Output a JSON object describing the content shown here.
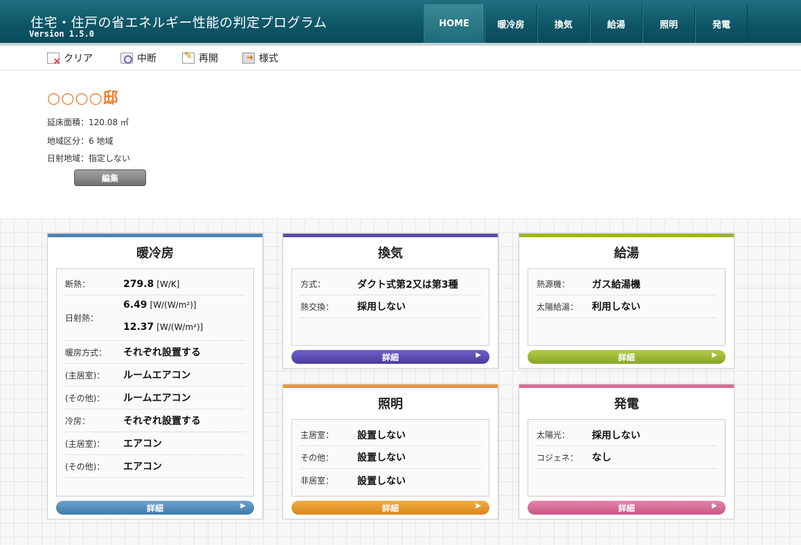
{
  "header": {
    "title": "住宅・住戸の省エネルギー性能の判定プログラム",
    "version": "Version 1.5.0",
    "nav": [
      "HOME",
      "暖冷房",
      "換気",
      "給湯",
      "照明",
      "発電"
    ]
  },
  "toolbar": {
    "clear": "クリア",
    "pause": "中断",
    "resume": "再開",
    "format": "様式"
  },
  "property": {
    "name": "○○○○邸",
    "floor_area": "延床面積：120.08 ㎡",
    "region": "地域区分：6 地域",
    "solar_region": "日射地域：指定しない",
    "edit_label": "編集"
  },
  "panels": {
    "heating": {
      "title": "暖冷房",
      "color": "#4b86b4",
      "rows": [
        {
          "label": "断熱：",
          "value": "279.8",
          "unit": "[W/K]"
        },
        {
          "label": "日射熱：",
          "value": "6.49",
          "unit": "[W/(W/m²)]"
        },
        {
          "label": "",
          "value": "12.37",
          "unit": "[W/(W/m²)]"
        },
        {
          "label": "暖房方式：",
          "value": "それぞれ設置する",
          "unit": ""
        },
        {
          "label": "(主居室)：",
          "value": "ルームエアコン",
          "unit": ""
        },
        {
          "label": "(その他)：",
          "value": "ルームエアコン",
          "unit": ""
        },
        {
          "label": "冷房：",
          "value": "それぞれ設置する",
          "unit": ""
        },
        {
          "label": "(主居室)：",
          "value": "エアコン",
          "unit": ""
        },
        {
          "label": "(その他)：",
          "value": "エアコン",
          "unit": ""
        }
      ],
      "detail": "詳細"
    },
    "ventilation": {
      "title": "換気",
      "color": "#5a4ab0",
      "rows": [
        {
          "label": "方式：",
          "value": "ダクト式第2又は第3種"
        },
        {
          "label": "熱交換：",
          "value": "採用しない"
        }
      ],
      "detail": "詳細"
    },
    "hotwater": {
      "title": "給湯",
      "color": "#9ab52e",
      "rows": [
        {
          "label": "熱源機：",
          "value": "ガス給湯機"
        },
        {
          "label": "太陽給湯：",
          "value": "利用しない"
        }
      ],
      "detail": "詳細"
    },
    "lighting": {
      "title": "照明",
      "color": "#e79b2a",
      "rows": [
        {
          "label": "主居室：",
          "value": "設置しない"
        },
        {
          "label": "その他：",
          "value": "設置しない"
        },
        {
          "label": "非居室：",
          "value": "設置しない"
        }
      ],
      "detail": "詳細"
    },
    "power": {
      "title": "発電",
      "color": "#d86c96",
      "rows": [
        {
          "label": "太陽光：",
          "value": "採用しない"
        },
        {
          "label": "コジェネ：",
          "value": "なし"
        }
      ],
      "detail": "詳細"
    }
  }
}
